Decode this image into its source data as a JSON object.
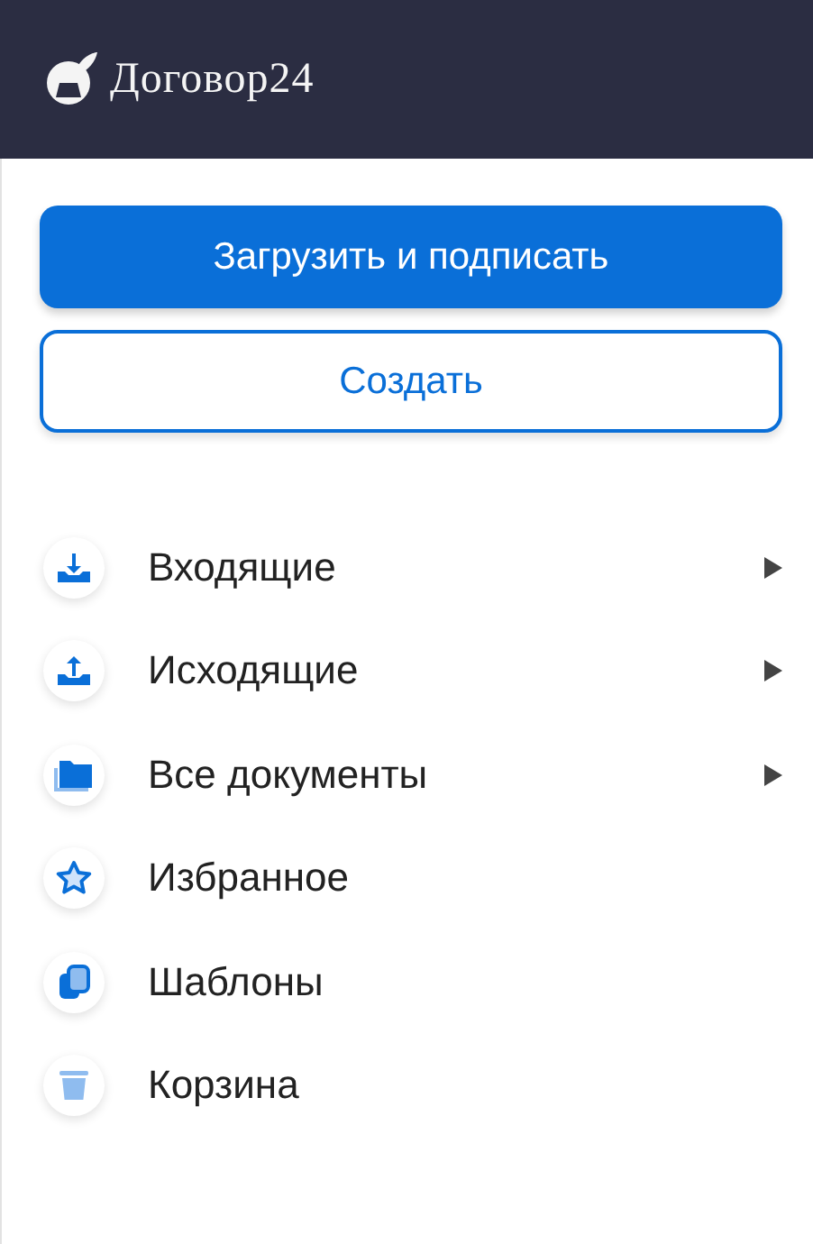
{
  "header": {
    "logo_text": "Договор24"
  },
  "buttons": [
    {
      "label": "Загрузить и подписать",
      "kind": "primary"
    },
    {
      "label": "Создать",
      "kind": "outline"
    }
  ],
  "menu": [
    {
      "label": "Входящие",
      "kind": "inbox",
      "has_submenu": true
    },
    {
      "label": "Исходящие",
      "kind": "outbox",
      "has_submenu": true
    },
    {
      "label": "Все документы",
      "kind": "folder",
      "has_submenu": true
    },
    {
      "label": "Избранное",
      "kind": "star",
      "has_submenu": false
    },
    {
      "label": "Шаблоны",
      "kind": "copy",
      "has_submenu": false
    },
    {
      "label": "Корзина",
      "kind": "trash",
      "has_submenu": false
    }
  ]
}
